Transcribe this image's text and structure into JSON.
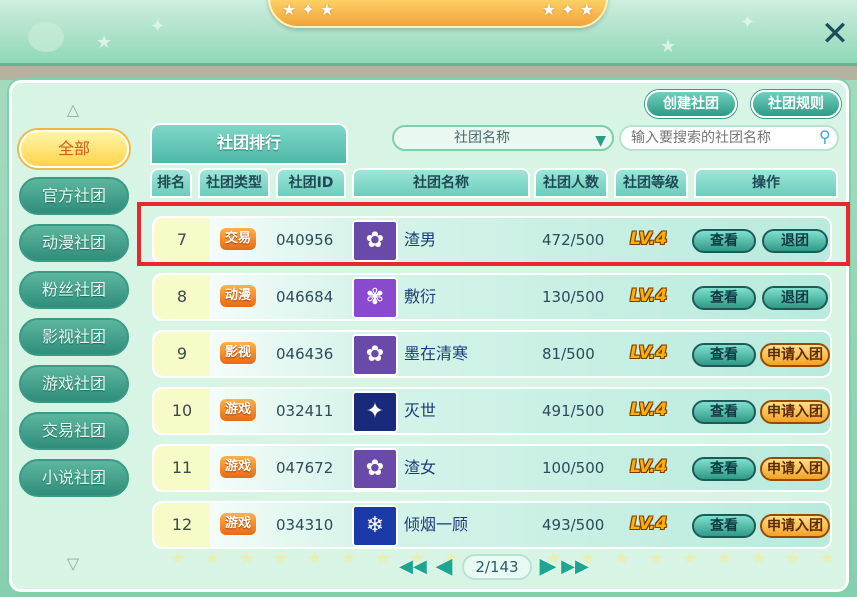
{
  "top": {
    "close_glyph": "✕",
    "title_stars_left": "★ ✦ ★",
    "title_stars_right": "★ ✦ ★"
  },
  "sidebar": {
    "up_glyph": "△",
    "down_glyph": "▽",
    "items": [
      {
        "label": "全部",
        "active": true
      },
      {
        "label": "官方社团",
        "active": false
      },
      {
        "label": "动漫社团",
        "active": false
      },
      {
        "label": "粉丝社团",
        "active": false
      },
      {
        "label": "影视社团",
        "active": false
      },
      {
        "label": "游戏社团",
        "active": false
      },
      {
        "label": "交易社团",
        "active": false
      },
      {
        "label": "小说社团",
        "active": false
      }
    ]
  },
  "toolbar": {
    "tab_label": "社团排行",
    "create_label": "创建社团",
    "rules_label": "社团规则",
    "select_value": "社团名称",
    "search_placeholder": "输入要搜索的社团名称"
  },
  "table": {
    "headers": [
      "排名",
      "社团类型",
      "社团ID",
      "社团名称",
      "社团人数",
      "社团等级",
      "操作"
    ],
    "rows": [
      {
        "rank": "7",
        "type": "交易",
        "id": "040956",
        "name": "渣男",
        "members": "472/500",
        "level": "LV.4",
        "action1": "查看",
        "action2": "退团",
        "avatar_icon": "flower-icon",
        "avatar_color": "#6a4aa8"
      },
      {
        "rank": "8",
        "type": "动漫",
        "id": "046684",
        "name": "敷衍",
        "members": "130/500",
        "level": "LV.4",
        "action1": "查看",
        "action2": "退团",
        "avatar_icon": "flower-icon",
        "avatar_color": "#8a4ad0"
      },
      {
        "rank": "9",
        "type": "影视",
        "id": "046436",
        "name": "墨在清寒",
        "members": "81/500",
        "level": "LV.4",
        "action1": "查看",
        "action2": "申请入团",
        "avatar_icon": "flower-icon",
        "avatar_color": "#6a4aa8"
      },
      {
        "rank": "10",
        "type": "游戏",
        "id": "032411",
        "name": "灭世",
        "members": "491/500",
        "level": "LV.4",
        "action1": "查看",
        "action2": "申请入团",
        "avatar_icon": "star-icon",
        "avatar_color": "#1a2a7a"
      },
      {
        "rank": "11",
        "type": "游戏",
        "id": "047672",
        "name": "渣女",
        "members": "100/500",
        "level": "LV.4",
        "action1": "查看",
        "action2": "申请入团",
        "avatar_icon": "flower-icon",
        "avatar_color": "#6a4aa8"
      },
      {
        "rank": "12",
        "type": "游戏",
        "id": "034310",
        "name": "倾烟一顾",
        "members": "493/500",
        "level": "LV.4",
        "action1": "查看",
        "action2": "申请入团",
        "avatar_icon": "snowflake-icon",
        "avatar_color": "#1a3aa8"
      }
    ]
  },
  "pager": {
    "first_glyph": "◀◀",
    "prev_glyph": "◀",
    "next_glyph": "▶",
    "last_glyph": "▶▶",
    "page": "2/143"
  },
  "colors": {
    "highlight": "#e8282e",
    "active_tab": "#ffd44a",
    "accent": "#2f9a86"
  }
}
